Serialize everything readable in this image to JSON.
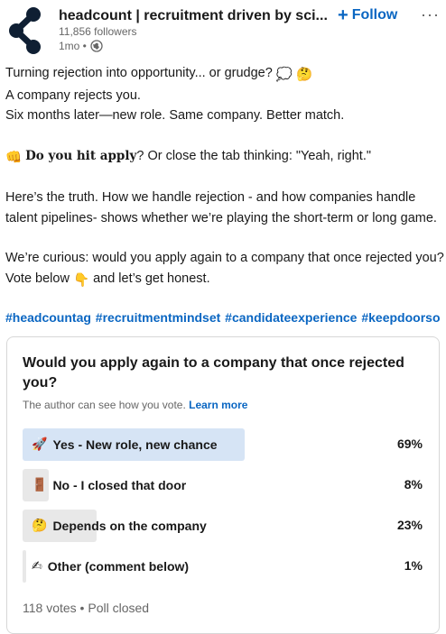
{
  "header": {
    "company_name": "headcount | recruitment driven by sci...",
    "followers": "11,856 followers",
    "time": "1mo •",
    "follow_label": "Follow",
    "more_label": "···"
  },
  "post": {
    "line1": "Turning rejection into opportunity... or grudge?",
    "line2": "A company rejects you.",
    "line3": "Six months later—new role. Same company. Better match.",
    "line4_bold": "Do you hit apply",
    "line4_rest": "? Or close the tab thinking: \"Yeah, right.\"",
    "line5": "Here’s the truth. How we handle rejection - and how companies handle",
    "line6": "talent pipelines- shows whether we’re playing the short-term or long game.",
    "line7": "We’re curious: would you apply again to a company that once rejected you?",
    "line8a": "Vote below",
    "line8b": "and let’s get honest."
  },
  "hashtags": [
    "#headcountag",
    "#recruitmentmindset",
    "#candidateexperience",
    "#keepdoorso"
  ],
  "poll": {
    "question": "Would you apply again to a company that once rejected you?",
    "note": "The author can see how you vote.",
    "learn_more": "Learn more",
    "options": [
      {
        "emoji": "🚀",
        "label": "Yes - New role, new chance",
        "percent": "69%",
        "fraction": 0.69
      },
      {
        "emoji": "🚪",
        "label": "No - I closed that door",
        "percent": "8%",
        "fraction": 0.08
      },
      {
        "emoji": "🤔",
        "label": "Depends on the company",
        "percent": "23%",
        "fraction": 0.23
      },
      {
        "emoji": "✍",
        "label": "Other (comment below)",
        "percent": "1%",
        "fraction": 0.01
      }
    ],
    "footer": "118 votes • Poll closed"
  },
  "colors": {
    "accent": "#0a66c2",
    "winning_bar": "#d6e4f5",
    "bar": "#e8e8e8"
  }
}
